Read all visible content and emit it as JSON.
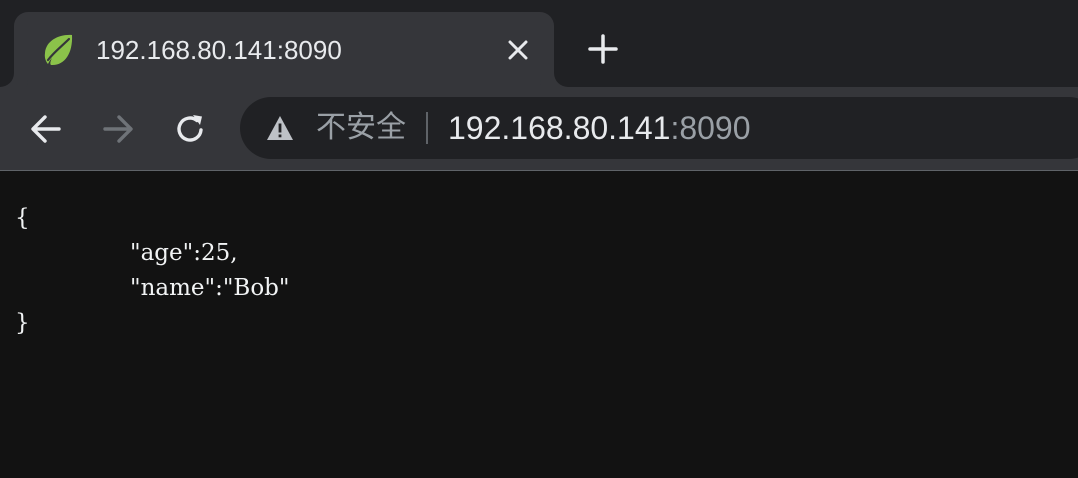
{
  "tab": {
    "title": "192.168.80.141:8090",
    "favicon": "spring-leaf-icon",
    "close_icon": "close-icon"
  },
  "toolbar": {
    "back_icon": "arrow-back-icon",
    "forward_icon": "arrow-forward-icon",
    "reload_icon": "reload-icon",
    "new_tab_icon": "plus-icon"
  },
  "omnibox": {
    "security_icon": "warning-triangle-icon",
    "security_label": "不安全",
    "url_host": "192.168.80.141",
    "url_port": ":8090"
  },
  "page": {
    "open_brace": "{",
    "line1": "\"age\":25,",
    "line2": "\"name\":\"Bob\"",
    "close_brace": "}"
  },
  "colors": {
    "tabstrip_bg": "#202124",
    "toolbar_bg": "#35363a",
    "page_bg": "#121212",
    "text_primary": "#e8eaed",
    "text_muted": "#9aa0a6",
    "favicon_green": "#8bc34a"
  }
}
